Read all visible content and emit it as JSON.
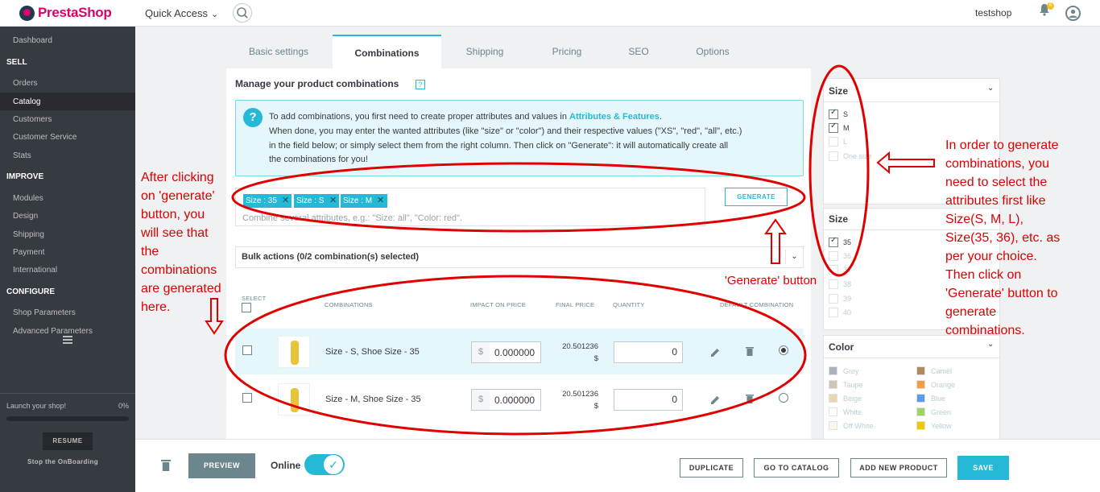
{
  "header": {
    "logo": "PrestaShop",
    "quick_access": "Quick Access",
    "shop": "testshop",
    "notif_count": "6"
  },
  "sidebar": {
    "dashboard": "Dashboard",
    "sell": "SELL",
    "orders": "Orders",
    "catalog": "Catalog",
    "customers": "Customers",
    "customer_service": "Customer Service",
    "stats": "Stats",
    "improve": "IMPROVE",
    "modules": "Modules",
    "design": "Design",
    "shipping": "Shipping",
    "payment": "Payment",
    "international": "International",
    "configure": "CONFIGURE",
    "shop_params": "Shop Parameters",
    "adv_params": "Advanced Parameters",
    "launch": "Launch your shop!",
    "launch_pct": "0%",
    "resume": "RESUME",
    "stop": "Stop the OnBoarding"
  },
  "tabs": {
    "basic": "Basic settings",
    "combinations": "Combinations",
    "shipping": "Shipping",
    "pricing": "Pricing",
    "seo": "SEO",
    "options": "Options"
  },
  "main": {
    "title": "Manage your product combinations",
    "help": "?",
    "info_1a": "To add combinations, you first need to create proper attributes and values in ",
    "info_1b": "Attributes & Features",
    "info_1c": ".",
    "info_2": "When done, you may enter the wanted attributes (like \"size\" or \"color\") and their respective values (\"XS\", \"red\", \"all\", etc.)",
    "info_3": "in the field below; or simply select them from the right column. Then click on \"Generate\": it will automatically create all",
    "info_4": "the combinations for you!",
    "tags": [
      "Size : 35",
      "Size : S",
      "Size : M"
    ],
    "attr_placeholder": "Combine several attributes, e.g.: \"Size: all\", \"Color: red\".",
    "generate": "GENERATE",
    "bulk": "Bulk actions (0/2 combination(s) selected)"
  },
  "table": {
    "headers": {
      "select": "SELECT",
      "combinations": "COMBINATIONS",
      "impact": "IMPACT ON PRICE",
      "final": "FINAL PRICE",
      "quantity": "QUANTITY",
      "default": "DEFAULT COMBINATION"
    },
    "rows": [
      {
        "name": "Size - S, Shoe Size - 35",
        "currency": "$",
        "impact": "0.000000",
        "final": "20.501236",
        "final_cur": "$",
        "qty": "0",
        "default": true
      },
      {
        "name": "Size - M, Shoe Size - 35",
        "currency": "$",
        "impact": "0.000000",
        "final": "20.501236",
        "final_cur": "$",
        "qty": "0",
        "default": false
      }
    ]
  },
  "attributes": {
    "size": {
      "title": "Size",
      "items": [
        "S",
        "M",
        "L",
        "One size"
      ]
    },
    "shoe_size": {
      "title": "Size",
      "items": [
        "35",
        "36",
        "37",
        "38",
        "39",
        "40"
      ]
    },
    "color": {
      "title": "Color",
      "left": [
        {
          "name": "Grey",
          "color": "#aab2bd"
        },
        {
          "name": "Taupe",
          "color": "#d1c5b4"
        },
        {
          "name": "Beige",
          "color": "#e8d8b0"
        },
        {
          "name": "White",
          "color": "#ffffff"
        },
        {
          "name": "Off White",
          "color": "#faf6ea"
        }
      ],
      "right": [
        {
          "name": "Camel",
          "color": "#b08a5a"
        },
        {
          "name": "Orange",
          "color": "#f39d42"
        },
        {
          "name": "Blue",
          "color": "#5d9cec"
        },
        {
          "name": "Green",
          "color": "#a0d468"
        },
        {
          "name": "Yellow",
          "color": "#f1c40f"
        }
      ]
    }
  },
  "footer": {
    "preview": "PREVIEW",
    "online": "Online",
    "duplicate": "DUPLICATE",
    "go_catalog": "GO TO CATALOG",
    "add_new": "ADD NEW PRODUCT",
    "save": "SAVE"
  },
  "annotations": {
    "left": [
      "After clicking",
      "on 'generate'",
      "button, you",
      "will see that",
      "the",
      "combinations",
      "are generated",
      "here."
    ],
    "generate_label": "'Generate' button",
    "right": [
      "In order to generate",
      "combinations, you",
      "need to select the",
      "attributes first like",
      "Size(S, M, L),",
      "Size(35, 36), etc. as",
      "per your choice.",
      "Then click on",
      "'Generate' button to",
      "generate",
      "combinations."
    ]
  },
  "colors": {
    "accent": "#25b9d7",
    "sidebar": "#363a41",
    "annotation": "#e00000",
    "brand": "#df0067"
  }
}
